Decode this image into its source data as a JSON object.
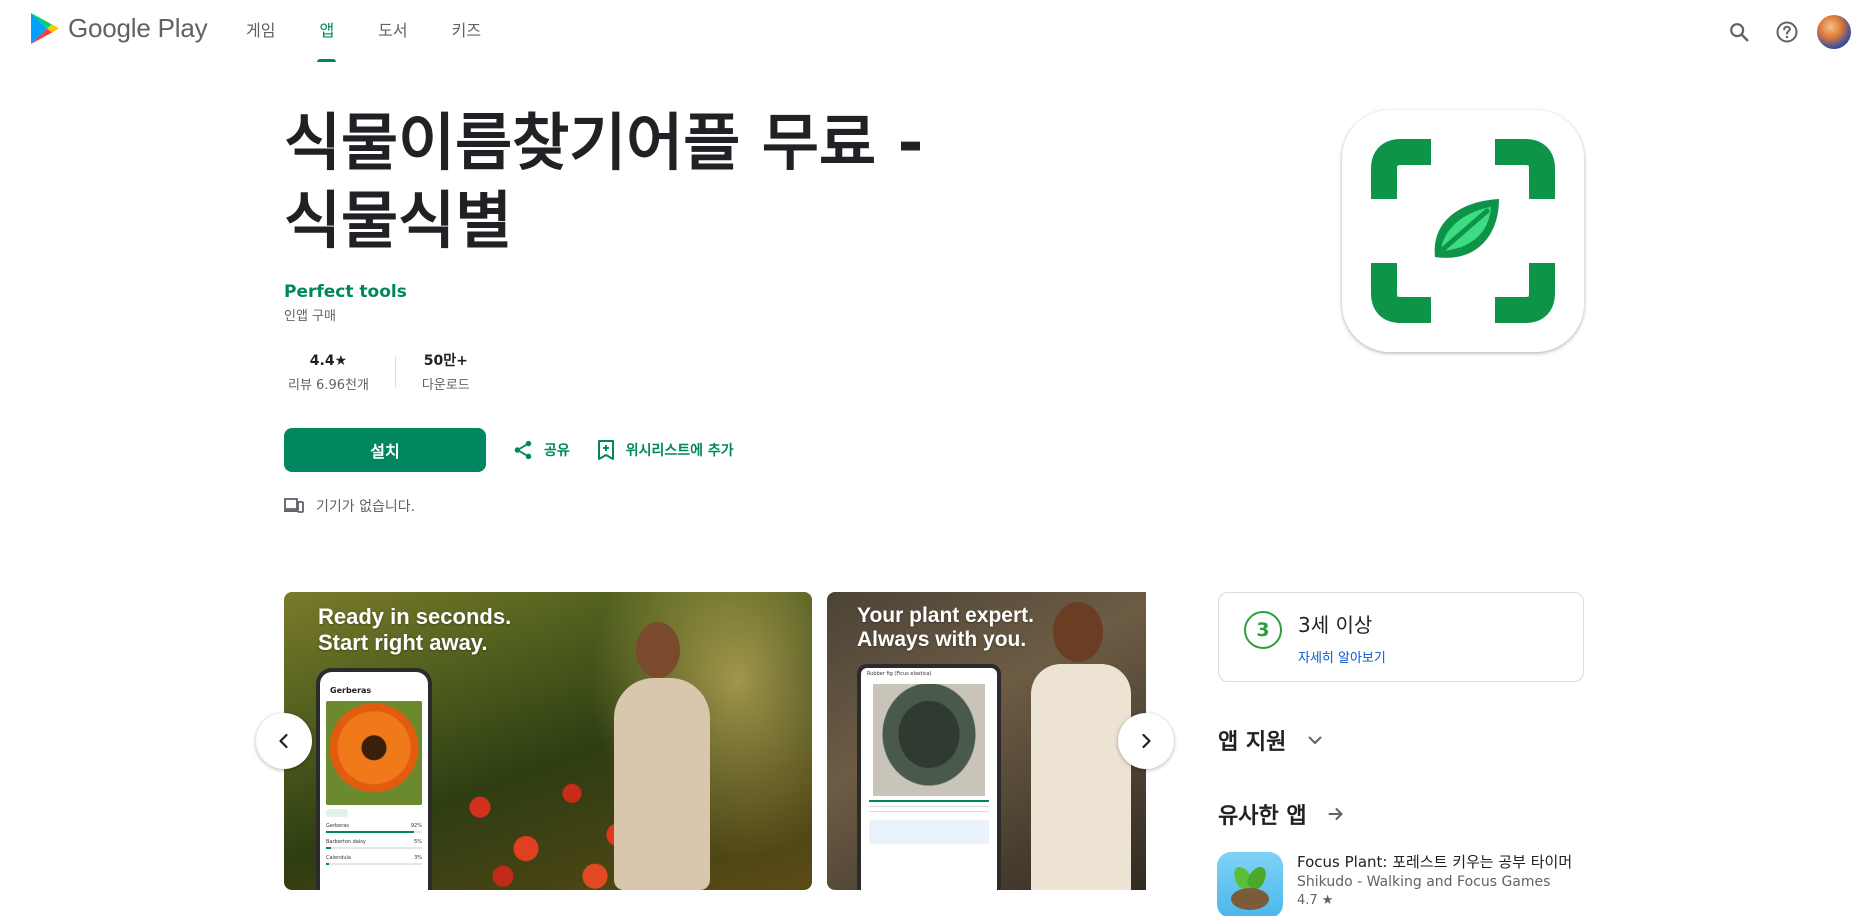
{
  "header": {
    "brand": "Google Play",
    "nav": [
      {
        "label": "게임"
      },
      {
        "label": "앱"
      },
      {
        "label": "도서"
      },
      {
        "label": "키즈"
      }
    ],
    "active_nav": "앱"
  },
  "app": {
    "title_line1": "식물이름찾기어플 무료 -",
    "title_line2": "식물식별",
    "developer": "Perfect tools",
    "in_app_purchase": "인앱 구매",
    "stats": [
      {
        "value": "4.4★",
        "label": "리뷰 6.96천개"
      },
      {
        "value": "50만+",
        "label": "다운로드"
      }
    ],
    "install_label": "설치",
    "share_label": "공유",
    "wishlist_label": "위시리스트에 추가",
    "device_note": "기기가 없습니다.",
    "icon": "leaf-scan-icon",
    "brand_color": "#01875f",
    "icon_color": "#0e9449"
  },
  "screenshots": [
    {
      "caption_line1": "Ready in seconds.",
      "caption_line2": "Start right away.",
      "phone_title": "Gerberas",
      "rows": [
        {
          "name": "Gerberas",
          "pct": "92%"
        },
        {
          "name": "Barberton daisy",
          "pct": "5%"
        },
        {
          "name": "Calendula",
          "pct": "3%"
        }
      ]
    },
    {
      "caption_line1": "Your plant expert.",
      "caption_line2": "Always with you.",
      "tablet_title": "Rubber fig (Ficus elastica)"
    }
  ],
  "rating": {
    "badge": "3",
    "title": "3세 이상",
    "link": "자세히 알아보기"
  },
  "sections": {
    "support": "앱 지원",
    "similar": "유사한 앱"
  },
  "similar_apps": [
    {
      "name": "Focus Plant: 포레스트 키우는 공부 타이머",
      "developer": "Shikudo - Walking and Focus Games",
      "rating": "4.7 ★"
    }
  ]
}
